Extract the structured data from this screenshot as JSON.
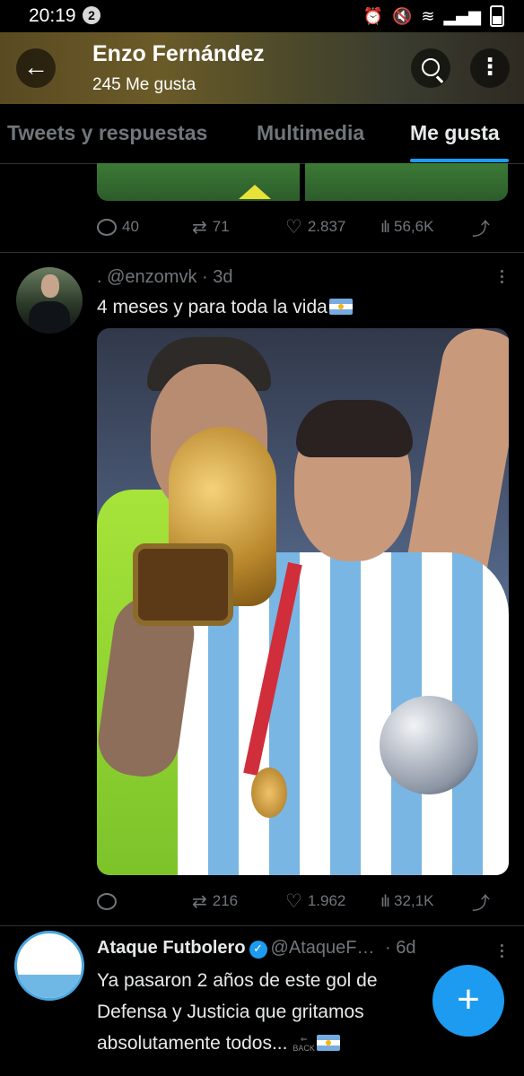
{
  "status_bar": {
    "time": "20:19",
    "notification_count": "2"
  },
  "header": {
    "title": "Enzo Fernández",
    "subtitle": "245 Me gusta"
  },
  "tabs": [
    {
      "label": "Tweets y respuestas",
      "active": false
    },
    {
      "label": "Multimedia",
      "active": false
    },
    {
      "label": "Me gusta",
      "active": true
    }
  ],
  "tweet1": {
    "replies": "40",
    "retweets": "71",
    "likes": "2.837",
    "views": "56,6K"
  },
  "tweet2": {
    "handle": ". @enzomvk · 3d",
    "text": "4 meses y para toda la vida",
    "replies": "",
    "retweets": "216",
    "likes": "1.962",
    "views": "32,1K"
  },
  "tweet3": {
    "name": "Ataque Futbolero",
    "handle": "@AtaqueF…",
    "time": "· 6d",
    "text_lines": [
      "Ya pasaron 2 años de este gol de",
      "Defensa y Justicia que gritamos",
      "absolutamente todos..."
    ],
    "back_badge": "BACK"
  },
  "fab": {
    "symbol": "+"
  },
  "colors": {
    "accent": "#1d9bf0",
    "background": "#000000",
    "muted": "#71767b"
  },
  "icons": [
    "back-arrow-icon",
    "search-icon",
    "more-vertical-icon",
    "reply-icon",
    "retweet-icon",
    "like-icon",
    "views-icon",
    "share-icon",
    "verified-icon",
    "argentina-flag-icon"
  ]
}
